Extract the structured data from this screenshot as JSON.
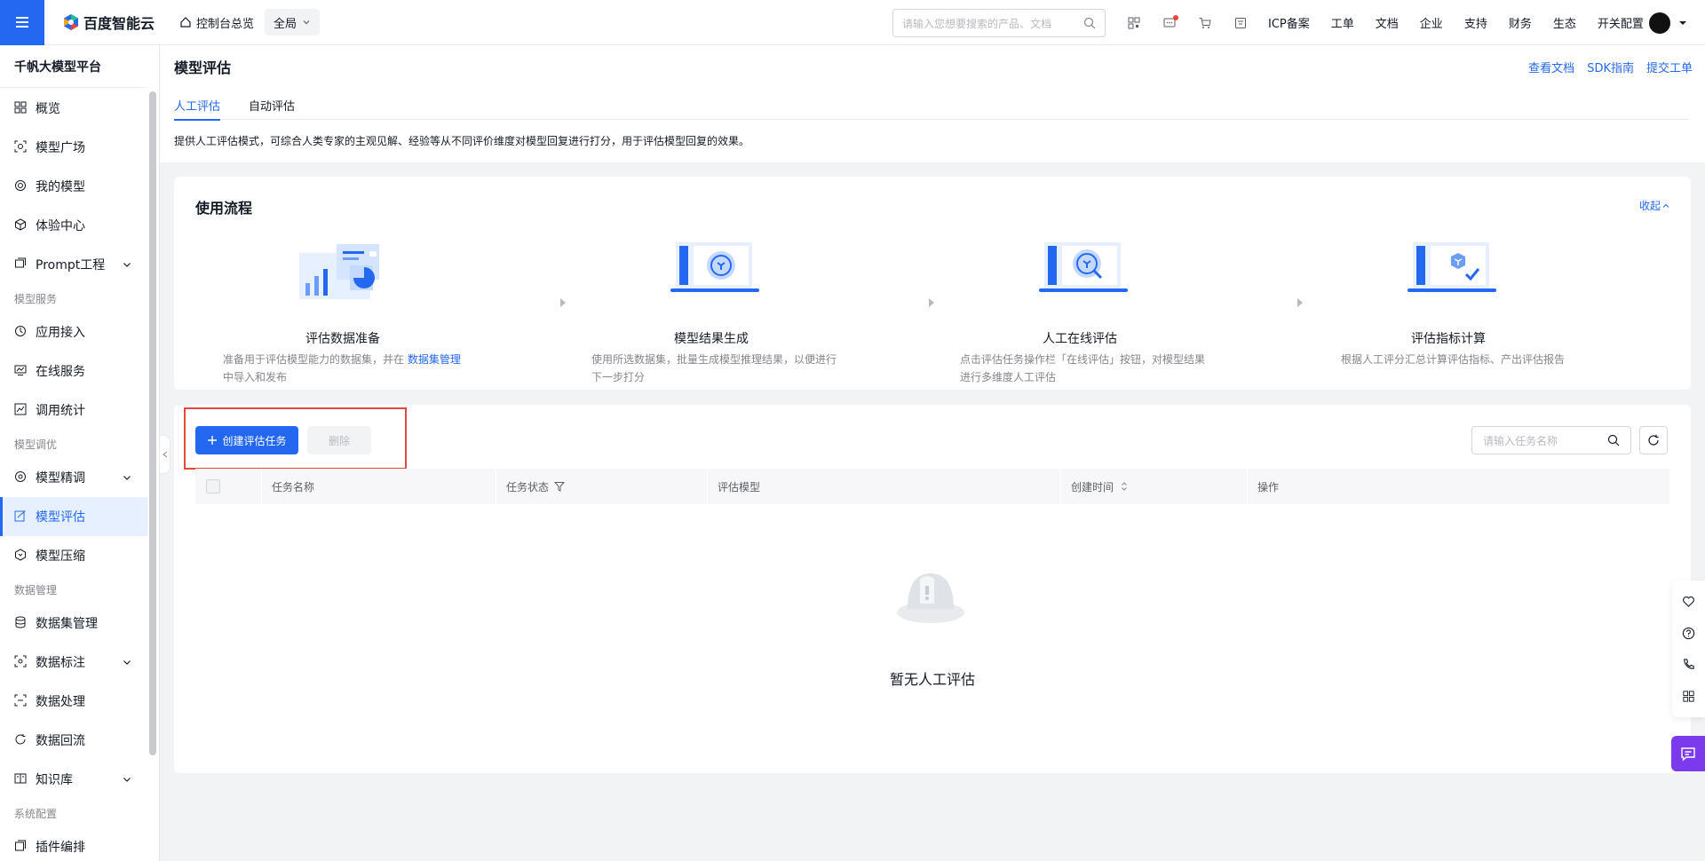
{
  "topbar": {
    "brand": "百度智能云",
    "console_home": "控制台总览",
    "region": "全局",
    "search_placeholder": "请输入您想要搜索的产品、文档",
    "nav": [
      "ICP备案",
      "工单",
      "文档",
      "企业",
      "支持",
      "财务",
      "生态",
      "开关配置"
    ]
  },
  "sidebar": {
    "title": "千帆大模型平台",
    "items": [
      {
        "label": "概览"
      },
      {
        "label": "模型广场"
      },
      {
        "label": "我的模型"
      },
      {
        "label": "体验中心"
      },
      {
        "label": "Prompt工程"
      }
    ],
    "group_service": "模型服务",
    "service_items": [
      {
        "label": "应用接入"
      },
      {
        "label": "在线服务"
      },
      {
        "label": "调用统计"
      }
    ],
    "group_tune": "模型调优",
    "tune_items": [
      {
        "label": "模型精调"
      },
      {
        "label": "模型评估"
      },
      {
        "label": "模型压缩"
      }
    ],
    "group_data": "数据管理",
    "data_items": [
      {
        "label": "数据集管理"
      },
      {
        "label": "数据标注"
      },
      {
        "label": "数据处理"
      },
      {
        "label": "数据回流"
      },
      {
        "label": "知识库"
      }
    ],
    "group_sys": "系统配置",
    "sys_items": [
      {
        "label": "插件编排"
      }
    ]
  },
  "page": {
    "title": "模型评估",
    "links": [
      "查看文档",
      "SDK指南",
      "提交工单"
    ],
    "tabs": [
      "人工评估",
      "自动评估"
    ],
    "description": "提供人工评估模式，可综合人类专家的主观见解、经验等从不同评价维度对模型回复进行打分，用于评估模型回复的效果。"
  },
  "flow": {
    "title": "使用流程",
    "collapse": "收起",
    "steps": [
      {
        "title": "评估数据准备",
        "desc_pre": "准备用于评估模型能力的数据集，并在 ",
        "desc_link": "数据集管理",
        "desc_post": "中导入和发布"
      },
      {
        "title": "模型结果生成",
        "desc": "使用所选数据集，批量生成模型推理结果，以便进行下一步打分"
      },
      {
        "title": "人工在线评估",
        "desc": "点击评估任务操作栏「在线评估」按钮，对模型结果进行多维度人工评估"
      },
      {
        "title": "评估指标计算",
        "desc": "根据人工评分汇总计算评估指标、产出评估报告"
      }
    ]
  },
  "list": {
    "create_label": "创建评估任务",
    "delete_label": "删除",
    "search_placeholder": "请输入任务名称",
    "columns": [
      "任务名称",
      "任务状态",
      "评估模型",
      "创建时间",
      "操作"
    ],
    "empty_text": "暂无人工评估"
  },
  "colors": {
    "accent": "#2468f2",
    "highlight": "#e2483d",
    "chat": "#7c3aed"
  }
}
